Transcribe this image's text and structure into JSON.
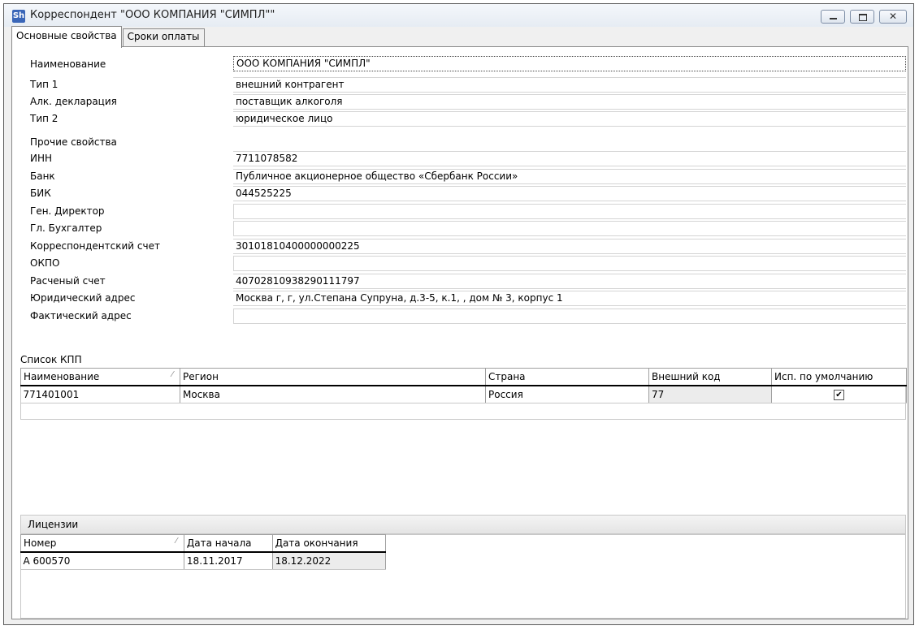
{
  "window": {
    "title": "Корреспондент \"ООО КОМПАНИЯ \"СИМПЛ\"\"",
    "app_icon_text": "Sh",
    "buttons": {
      "minimize": "minimize-icon",
      "maximize": "maximize-icon",
      "close": "close-icon"
    }
  },
  "tabs": [
    {
      "label": "Основные свойства",
      "active": true
    },
    {
      "label": "Сроки оплаты",
      "active": false
    }
  ],
  "properties": {
    "name_label": "Наименование",
    "name_value": "ООО КОМПАНИЯ \"СИМПЛ\"",
    "type1_label": "Тип 1",
    "type1_value": "внешний контрагент",
    "alc_label": "Алк. декларация",
    "alc_value": "поставщик алкоголя",
    "type2_label": "Тип 2",
    "type2_value": "юридическое лицо",
    "other_label": "Прочие свойства",
    "inn_label": "ИНН",
    "inn_value": "7711078582",
    "bank_label": "Банк",
    "bank_value": "Публичное акционерное общество «Сбербанк России»",
    "bik_label": "БИК",
    "bik_value": "044525225",
    "director_label": "Ген. Директор",
    "director_value": "",
    "accountant_label": "Гл. Бухгалтер",
    "accountant_value": "",
    "corr_label": "Корреспондентский счет",
    "corr_value": "30101810400000000225",
    "okpo_label": "ОКПО",
    "okpo_value": "",
    "account_label": "Расченый счет",
    "account_value": "40702810938290111797",
    "legal_label": "Юридический адрес",
    "legal_value": "Москва г, г, ул.Степана Супруна, д.3-5, к.1, , дом № 3, корпус 1",
    "actual_label": "Фактический адрес",
    "actual_value": ""
  },
  "kpp": {
    "section_label": "Список КПП",
    "columns": [
      "Наименование",
      "Регион",
      "Страна",
      "Внешний код",
      "Исп. по умолчанию"
    ],
    "rows": [
      {
        "name": "771401001",
        "region": "Москва",
        "country": "Россия",
        "ext_code": "77",
        "default": true
      }
    ]
  },
  "licenses": {
    "section_label": "Лицензии",
    "columns": [
      "Номер",
      "Дата начала",
      "Дата окончания"
    ],
    "rows": [
      {
        "number": "А 600570",
        "start": "18.11.2017",
        "end": "18.12.2022"
      }
    ]
  }
}
